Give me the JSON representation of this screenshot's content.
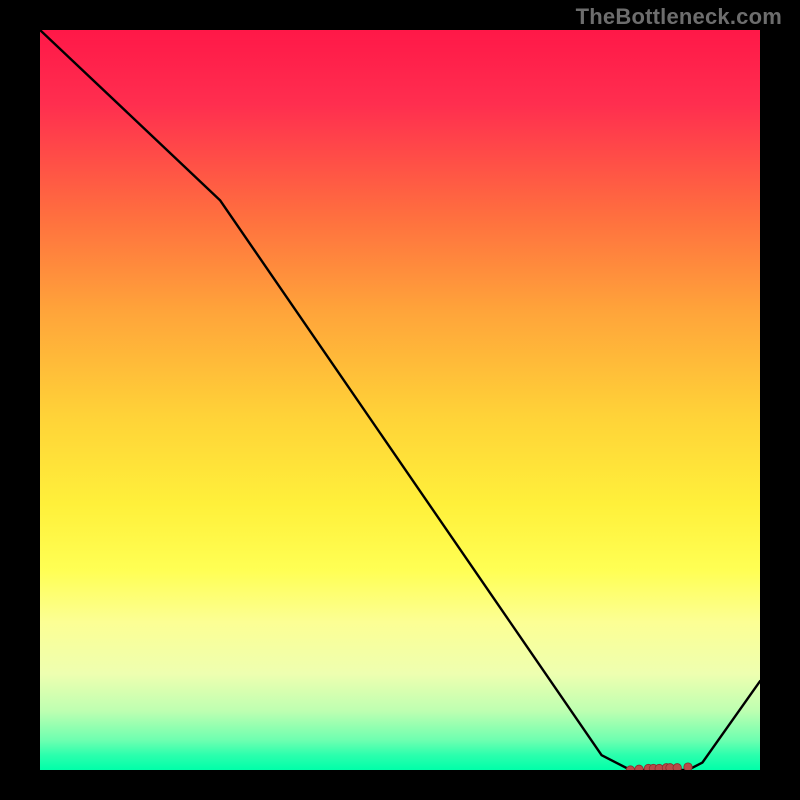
{
  "watermark": "TheBottleneck.com",
  "chart_data": {
    "type": "line",
    "title": "",
    "xlabel": "",
    "ylabel": "",
    "xlim": [
      0,
      100
    ],
    "ylim": [
      0,
      100
    ],
    "gradient_note": "background heatmap red (top) → yellow → green (bottom)",
    "series": [
      {
        "name": "curve",
        "x": [
          0,
          25,
          78,
          82,
          90,
          92,
          100
        ],
        "values": [
          100,
          77,
          2,
          0,
          0,
          1,
          12
        ]
      }
    ],
    "markers": {
      "name": "bottom-cluster",
      "style": "small-red-dots",
      "x": [
        82,
        83.2,
        84.5,
        85.2,
        86,
        87,
        87.5,
        88.5,
        90
      ],
      "values": [
        0,
        0.1,
        0.2,
        0.2,
        0.2,
        0.3,
        0.3,
        0.3,
        0.4
      ]
    }
  }
}
